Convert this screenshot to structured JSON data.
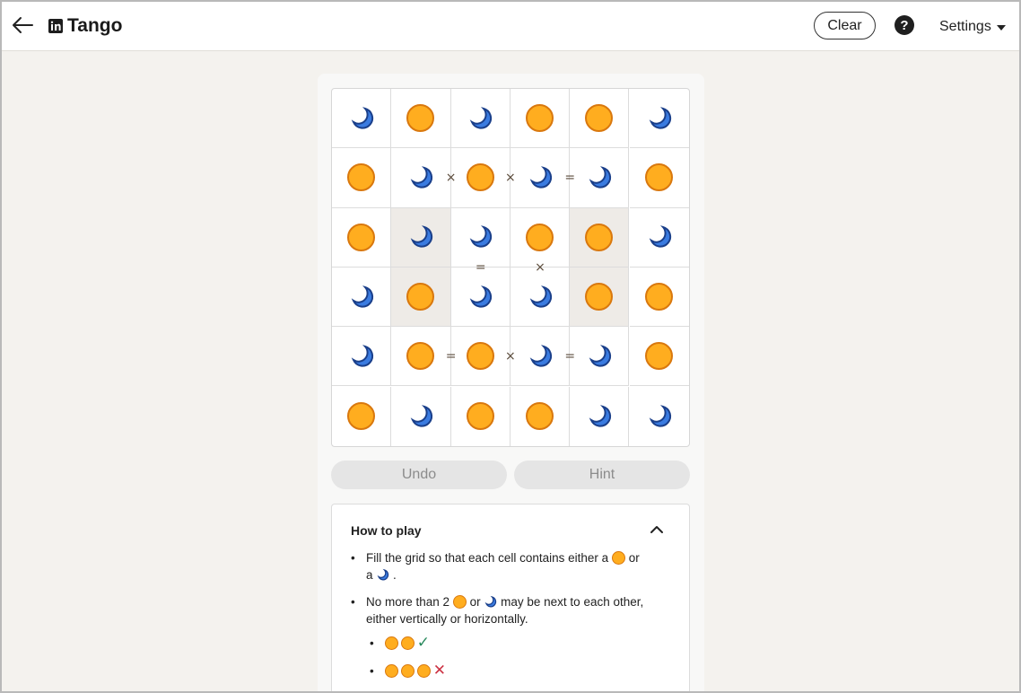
{
  "header": {
    "title": "Tango",
    "clear_label": "Clear",
    "help_label": "?",
    "settings_label": "Settings"
  },
  "board": {
    "rows": [
      [
        "moon",
        "sun",
        "moon",
        "sun",
        "sun",
        "moon"
      ],
      [
        "sun",
        "moon",
        "sun",
        "moon",
        "moon",
        "sun"
      ],
      [
        "sun",
        "moon",
        "moon",
        "sun",
        "sun",
        "moon"
      ],
      [
        "moon",
        "sun",
        "moon",
        "moon",
        "sun",
        "sun"
      ],
      [
        "moon",
        "sun",
        "sun",
        "moon",
        "moon",
        "sun"
      ],
      [
        "sun",
        "moon",
        "sun",
        "sun",
        "moon",
        "moon"
      ]
    ],
    "locked": [
      [
        2,
        1
      ],
      [
        3,
        1
      ],
      [
        2,
        4
      ],
      [
        3,
        4
      ]
    ],
    "constraints": [
      {
        "row": 1,
        "col": 1,
        "dir": "right",
        "sign": "×"
      },
      {
        "row": 1,
        "col": 2,
        "dir": "right",
        "sign": "×"
      },
      {
        "row": 1,
        "col": 3,
        "dir": "right",
        "sign": "="
      },
      {
        "row": 2,
        "col": 2,
        "dir": "down",
        "sign": "="
      },
      {
        "row": 2,
        "col": 3,
        "dir": "down",
        "sign": "×"
      },
      {
        "row": 4,
        "col": 1,
        "dir": "right",
        "sign": "="
      },
      {
        "row": 4,
        "col": 2,
        "dir": "right",
        "sign": "×"
      },
      {
        "row": 4,
        "col": 3,
        "dir": "right",
        "sign": "="
      }
    ],
    "colors": {
      "sun_fill": "#ffad1f",
      "sun_stroke": "#d9780e",
      "moon_fill": "#3a7be0",
      "moon_stroke": "#1a3f8a",
      "locked_bg": "#eeebe7"
    }
  },
  "controls": {
    "undo_label": "Undo",
    "hint_label": "Hint"
  },
  "how_to_play": {
    "title": "How to play",
    "rule1_a": "Fill the grid so that each cell contains either a",
    "rule1_b": "or",
    "rule1_c": "a",
    "rule1_d": ".",
    "rule2_a": "No more than 2",
    "rule2_b": "or",
    "rule2_c": "may be next to each other, either vertically or horizontally.",
    "example_ok": "✓",
    "example_bad": "✕"
  }
}
